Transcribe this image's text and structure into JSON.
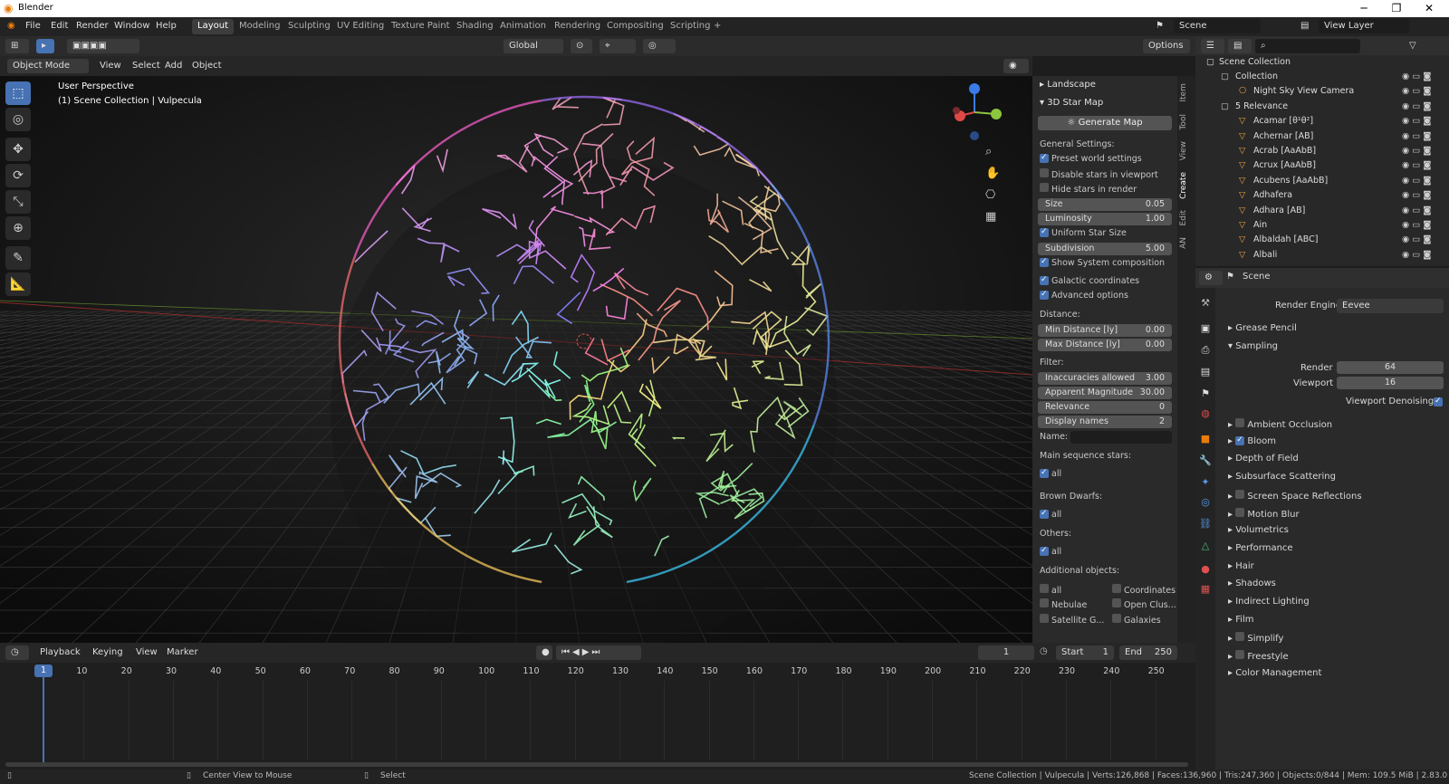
{
  "window": {
    "title": "Blender",
    "minimize": "─",
    "maximize": "❐",
    "close": "✕"
  },
  "menu": [
    "File",
    "Edit",
    "Render",
    "Window",
    "Help"
  ],
  "workspaces": [
    "Layout",
    "Modeling",
    "Sculpting",
    "UV Editing",
    "Texture Paint",
    "Shading",
    "Animation",
    "Rendering",
    "Compositing",
    "Scripting",
    "+"
  ],
  "active_workspace": "Layout",
  "scene": {
    "name": "Scene",
    "view_layer": "View Layer"
  },
  "tool_header": {
    "orientation": "Global",
    "options": "Options"
  },
  "viewport_header": {
    "mode": "Object Mode",
    "menus": [
      "View",
      "Select",
      "Add",
      "Object"
    ]
  },
  "viewport": {
    "perspective": "User Perspective",
    "collection": "(1) Scene Collection | Vulpecula"
  },
  "npanel": {
    "landscape": "Landscape",
    "star_map": "3D Star Map",
    "generate": "Generate Map",
    "general": "General Settings:",
    "preset": "Preset world settings",
    "disable_vp": "Disable stars in viewport",
    "hide_render": "Hide stars in render",
    "size_k": "Size",
    "size_v": "0.05",
    "lum_k": "Luminosity",
    "lum_v": "1.00",
    "uniform": "Uniform Star Size",
    "subdiv_k": "Subdivision",
    "subdiv_v": "5.00",
    "show_sys": "Show System composition",
    "galactic": "Galactic coordinates",
    "advanced": "Advanced options",
    "distance": "Distance:",
    "mind_k": "Min Distance [ly]",
    "mind_v": "0.00",
    "maxd_k": "Max Distance [ly]",
    "maxd_v": "0.00",
    "filter": "Filter:",
    "inacc_k": "Inaccuracies allowed",
    "inacc_v": "3.00",
    "mag_k": "Apparent Magnitude",
    "mag_v": "30.00",
    "rel_k": "Relevance",
    "rel_v": "0",
    "disp_k": "Display names",
    "disp_v": "2",
    "name": "Name:",
    "main_seq": "Main sequence stars:",
    "brown": "Brown Dwarfs:",
    "others": "Others:",
    "all": "all",
    "additional": "Additional objects:",
    "coordinates": "Coordinates",
    "nebulae": "Nebulae",
    "open_clus": "Open Clus...",
    "satellite": "Satellite G...",
    "galaxies": "Galaxies"
  },
  "ntabs": [
    "Item",
    "Tool",
    "View",
    "Create",
    "Edit",
    "AN"
  ],
  "outliner": {
    "root": "Scene Collection",
    "rows": [
      "Collection",
      "Night Sky View Camera",
      "5 Relevance",
      "Acamar [θ¹θ²]",
      "Achernar [AB]",
      "Acrab [AaAbB]",
      "Acrux [AaAbB]",
      "Acubens [AaAbB]",
      "Adhafera",
      "Adhara [AB]",
      "Ain",
      "Albaldah [ABC]",
      "Albali"
    ]
  },
  "properties": {
    "scene": "Scene",
    "render_engine_label": "Render Engine",
    "render_engine": "Eevee",
    "grease_pencil": "Grease Pencil",
    "sampling": "Sampling",
    "render_k": "Render",
    "render_v": "64",
    "viewport_k": "Viewport",
    "viewport_v": "16",
    "denoise": "Viewport Denoising",
    "sections": [
      "Ambient Occlusion",
      "Bloom",
      "Depth of Field",
      "Subsurface Scattering",
      "Screen Space Reflections",
      "Motion Blur",
      "Volumetrics",
      "Performance",
      "Hair",
      "Shadows",
      "Indirect Lighting",
      "Film",
      "Simplify",
      "Freestyle",
      "Color Management"
    ]
  },
  "timeline": {
    "menus": [
      "Playback",
      "Keying",
      "View",
      "Marker"
    ],
    "current": "1",
    "start_k": "Start",
    "start_v": "1",
    "end_k": "End",
    "end_v": "250",
    "ticks": [
      "1",
      "10",
      "20",
      "30",
      "40",
      "50",
      "60",
      "70",
      "80",
      "90",
      "100",
      "110",
      "120",
      "130",
      "140",
      "150",
      "160",
      "170",
      "180",
      "190",
      "200",
      "210",
      "220",
      "230",
      "240",
      "250"
    ]
  },
  "status": {
    "center": "Center View to Mouse",
    "select": "Select",
    "info": "Scene Collection | Vulpecula | Verts:126,868 | Faces:136,960 | Tris:247,360 | Objects:0/844 | Mem: 109.5 MiB | 2.83.0"
  }
}
